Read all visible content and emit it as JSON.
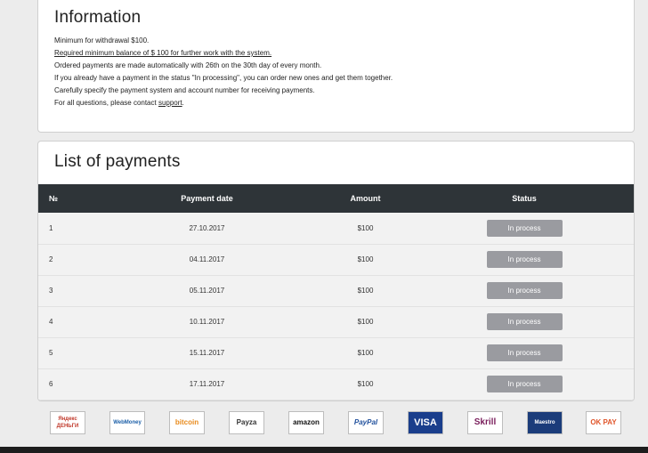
{
  "info": {
    "title": "Information",
    "lines": [
      "Minimum for withdrawal $100.",
      "Required minimum balance of $ 100 for further work with the system.",
      "Ordered payments are made automatically with 26th on the 30th day of every month.",
      "If you already have a payment in the status \"In processing\", you can order new ones and get them together.",
      "Carefully specify the payment system and account number for receiving payments."
    ],
    "contact_prefix": "For all questions, please contact ",
    "contact_link": "support",
    "contact_suffix": "."
  },
  "payments": {
    "title": "List of payments",
    "headers": {
      "num": "№",
      "date": "Payment date",
      "amount": "Amount",
      "status": "Status"
    },
    "rows": [
      {
        "num": "1",
        "date": "27.10.2017",
        "amount": "$100",
        "status": "In process"
      },
      {
        "num": "2",
        "date": "04.11.2017",
        "amount": "$100",
        "status": "In process"
      },
      {
        "num": "3",
        "date": "05.11.2017",
        "amount": "$100",
        "status": "In process"
      },
      {
        "num": "4",
        "date": "10.11.2017",
        "amount": "$100",
        "status": "In process"
      },
      {
        "num": "5",
        "date": "15.11.2017",
        "amount": "$100",
        "status": "In process"
      },
      {
        "num": "6",
        "date": "17.11.2017",
        "amount": "$100",
        "status": "In process"
      }
    ]
  },
  "payment_logos": [
    {
      "name": "yandex-money-logo",
      "text": "Яндекс ДЕНЬГИ"
    },
    {
      "name": "webmoney-logo",
      "text": "WebMoney"
    },
    {
      "name": "bitcoin-logo",
      "text": "bitcoin"
    },
    {
      "name": "payza-logo",
      "text": "Payza"
    },
    {
      "name": "amazon-logo",
      "text": "amazon"
    },
    {
      "name": "paypal-logo",
      "text": "PayPal"
    },
    {
      "name": "visa-logo",
      "text": "VISA"
    },
    {
      "name": "skrill-logo",
      "text": "Skrill"
    },
    {
      "name": "maestro-logo",
      "text": "Maestro"
    },
    {
      "name": "okpay-logo",
      "text": "OK PAY"
    }
  ],
  "colors": {
    "table_header": "#2e3438",
    "badge": "#9a9ba0",
    "row": "#f2f2f2",
    "bottom_bar": "#1d1d1d"
  }
}
